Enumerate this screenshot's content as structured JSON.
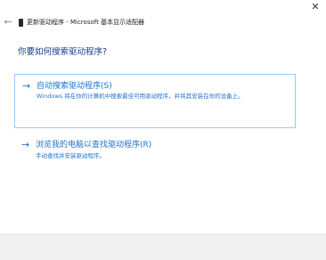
{
  "window": {
    "title": "更新驱动程序 - Microsoft 基本显示适配器",
    "close_glyph": "✕",
    "back_glyph": "←"
  },
  "main": {
    "heading": "你要如何搜索驱动程序?",
    "options": [
      {
        "title": "自动搜索驱动程序(S)",
        "description": "Windows 将在你的计算机中搜索最佳可用驱动程序，并将其安装在你的设备上。",
        "arrow": "→"
      },
      {
        "title": "浏览我的电脑以查找驱动程序(R)",
        "description": "手动查找并安装驱动程序。",
        "arrow": "→"
      }
    ]
  },
  "colors": {
    "accent": "#1e73c8",
    "heading": "#1a3e8c",
    "option_border": "#9cc9ef",
    "footer": "#f0f0f0"
  },
  "icons": {
    "close": "close-icon",
    "back": "back-arrow-icon",
    "device": "device-icon",
    "option_arrow": "arrow-right-icon"
  }
}
